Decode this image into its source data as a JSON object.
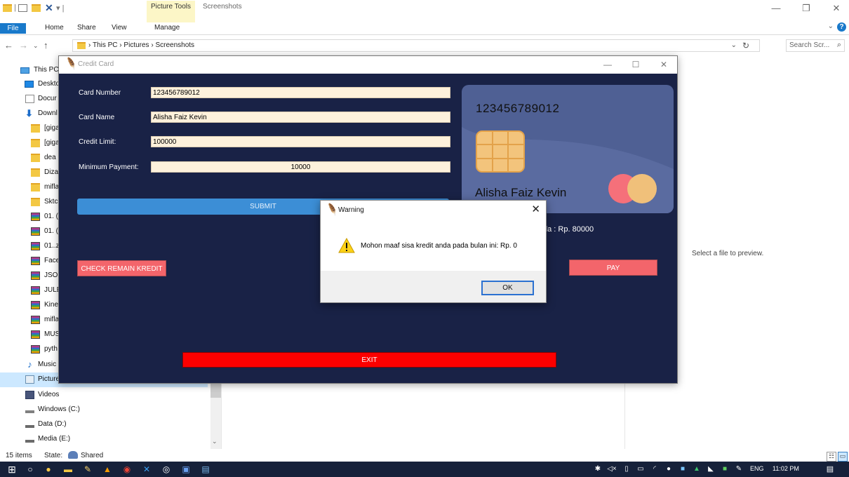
{
  "explorer": {
    "context_tab": "Picture Tools",
    "title": "Screenshots",
    "tabs": {
      "file": "File",
      "home": "Home",
      "share": "Share",
      "view": "View",
      "manage": "Manage"
    },
    "breadcrumb": {
      "root": "This PC",
      "sep": "›",
      "folder1": "Pictures",
      "folder2": "Screenshots"
    },
    "search_placeholder": "Search Scr...",
    "nav": {
      "this_pc": "This PC",
      "desktop": "Deskto",
      "documents": "Docur",
      "downloads": "Downl",
      "f1": "[giga",
      "f2": "[giga",
      "f3": "dea",
      "f4": "Dizat",
      "f5": "mifla",
      "f6": "Sktcl",
      "r1": "01. (",
      "r2": "01. (",
      "r3": "01..zi",
      "r4": "Face",
      "r5": "JSON",
      "r6": "JULE",
      "r7": "Kinel",
      "r8": "mifla",
      "r9": "MUS",
      "r10": "pyth",
      "music": "Music",
      "pictures": "Pictures",
      "videos": "Videos",
      "drive_c": "Windows (C:)",
      "drive_d": "Data (D:)",
      "drive_e": "Media (E:)"
    },
    "preview_text": "Select a file to preview.",
    "status": {
      "items": "15 items",
      "state": "State:",
      "shared": "Shared"
    }
  },
  "taskbar": {
    "lang": "ENG",
    "time": "11:02 PM"
  },
  "app": {
    "title": "Credit Card",
    "form": {
      "card_number_label": "Card Number",
      "card_number_value": "123456789012",
      "card_name_label": "Card Name",
      "card_name_value": "Alisha Faiz Kevin",
      "credit_limit_label": "Credit Limit:",
      "credit_limit_value": "100000",
      "min_payment_label": "Minimum Payment:",
      "min_payment_value": "10000"
    },
    "buttons": {
      "submit": "SUBMIT",
      "check": "CHECK REMAIN KREDIT",
      "pay": "PAY",
      "exit": "EXIT"
    },
    "card": {
      "number": "123456789012",
      "name": "Alisha Faiz Kevin"
    },
    "remain_text": "da : Rp. 80000"
  },
  "dialog": {
    "title": "Warning",
    "message": "Mohon maaf sisa kredit anda pada bulan ini: Rp. 0",
    "ok": "OK"
  },
  "colors": {
    "app_bg": "#192246",
    "card_bg": "#4f6094",
    "submit": "#3c8ed6",
    "pink_button": "#f3656b",
    "exit": "#fd0000",
    "input_bg": "#fdf1dc"
  }
}
